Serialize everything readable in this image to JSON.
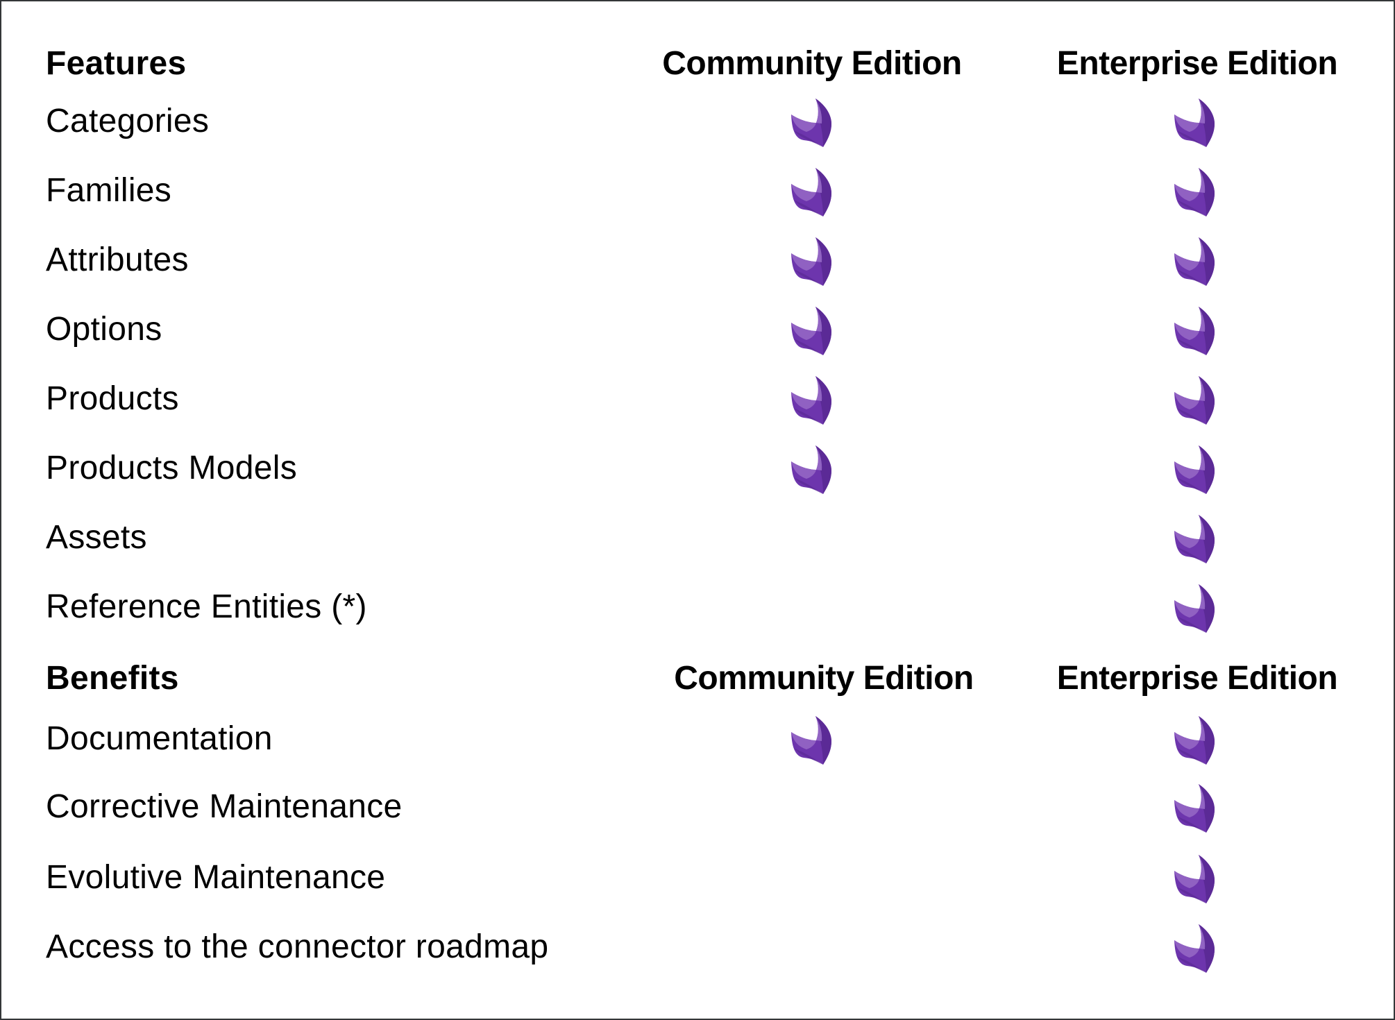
{
  "sections": [
    {
      "header": {
        "label": "Features",
        "community": "Community Edition",
        "enterprise": "Enterprise Edition"
      },
      "rows": [
        {
          "label": "Categories",
          "community": true,
          "enterprise": true
        },
        {
          "label": "Families",
          "community": true,
          "enterprise": true
        },
        {
          "label": "Attributes",
          "community": true,
          "enterprise": true
        },
        {
          "label": "Options",
          "community": true,
          "enterprise": true
        },
        {
          "label": "Products",
          "community": true,
          "enterprise": true
        },
        {
          "label": "Products Models",
          "community": true,
          "enterprise": true
        },
        {
          "label": "Assets",
          "community": false,
          "enterprise": true
        },
        {
          "label": "Reference Entities (*)",
          "community": false,
          "enterprise": true
        }
      ]
    },
    {
      "header": {
        "label": "Benefits",
        "community": "Community Edition",
        "enterprise": "Enterprise Edition"
      },
      "rows": [
        {
          "label": "Documentation",
          "community": true,
          "enterprise": true
        },
        {
          "label": "Corrective Maintenance",
          "community": false,
          "enterprise": true
        },
        {
          "label": "Evolutive Maintenance",
          "community": false,
          "enterprise": true
        },
        {
          "label": "Access to the connector roadmap",
          "community": false,
          "enterprise": true
        }
      ]
    }
  ],
  "icon": {
    "name": "akeneo-logo-check-icon",
    "colors": {
      "dark": "#5b2a96",
      "mid": "#6d35ad",
      "light": "#9669c6"
    }
  }
}
